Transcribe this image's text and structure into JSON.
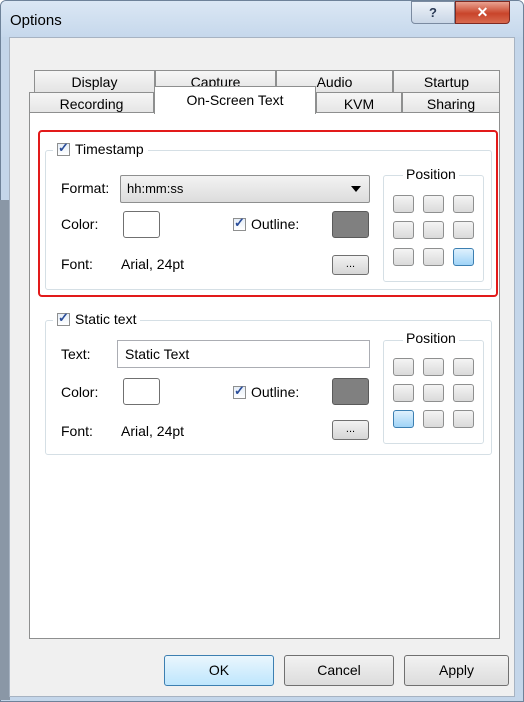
{
  "window": {
    "title": "Options",
    "help_glyph": "?",
    "close_glyph": "✕"
  },
  "tabs": {
    "row1": [
      "Display",
      "Capture",
      "Audio",
      "Startup"
    ],
    "row2": [
      "Recording",
      "On-Screen Text",
      "KVM",
      "Sharing"
    ],
    "active": "On-Screen Text"
  },
  "timestamp": {
    "checkbox_label": "Timestamp",
    "checked": true,
    "format_label": "Format:",
    "format_value": "hh:mm:ss",
    "color_label": "Color:",
    "color_value": "#ffffff",
    "outline_label": "Outline:",
    "outline_checked": true,
    "outline_color": "#808080",
    "font_label": "Font:",
    "font_value": "Arial, 24pt",
    "browse_label": "...",
    "position_label": "Position",
    "selected_position": "bottom-right"
  },
  "static_text": {
    "checkbox_label": "Static text",
    "checked": true,
    "text_label": "Text:",
    "text_value": "Static Text",
    "color_label": "Color:",
    "color_value": "#ffffff",
    "outline_label": "Outline:",
    "outline_checked": true,
    "outline_color": "#808080",
    "font_label": "Font:",
    "font_value": "Arial, 24pt",
    "browse_label": "...",
    "position_label": "Position",
    "selected_position": "bottom-left"
  },
  "buttons": {
    "ok": "OK",
    "cancel": "Cancel",
    "apply": "Apply"
  },
  "colors": {
    "highlight": "#e21a1a",
    "selected_cell": "#9fd3f7"
  }
}
